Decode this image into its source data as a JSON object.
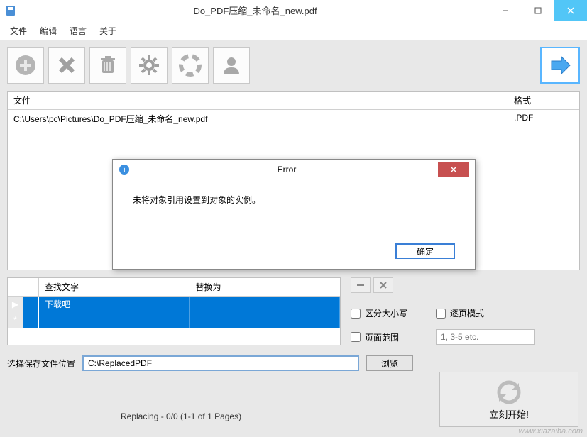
{
  "window": {
    "title": "Do_PDF压缩_未命名_new.pdf"
  },
  "menu": {
    "file": "文件",
    "edit": "编辑",
    "language": "语言",
    "about": "关于"
  },
  "file_list": {
    "header_file": "文件",
    "header_format": "格式",
    "rows": [
      {
        "path": "C:\\Users\\pc\\Pictures\\Do_PDF压缩_未命名_new.pdf",
        "format": ".PDF"
      }
    ]
  },
  "find_replace": {
    "header_find": "查找文字",
    "header_replace": "替换为",
    "rows": [
      {
        "marker": "▶",
        "find": "下载吧",
        "replace": ""
      },
      {
        "marker": "*",
        "find": "",
        "replace": ""
      }
    ]
  },
  "options": {
    "case_sensitive": "区分大小写",
    "page_mode": "逐页模式",
    "page_range": "页面范围",
    "page_range_placeholder": "1, 3-5 etc."
  },
  "save": {
    "label": "选择保存文件位置",
    "path": "C:\\ReplacedPDF",
    "browse": "浏览"
  },
  "start": {
    "label": "立刻开始!"
  },
  "status": {
    "text": "Replacing - 0/0 (1-1 of 1 Pages)"
  },
  "error": {
    "title": "Error",
    "message": "未将对象引用设置到对象的实例。",
    "ok": "确定"
  },
  "watermark": "www.xiazaiba.com"
}
